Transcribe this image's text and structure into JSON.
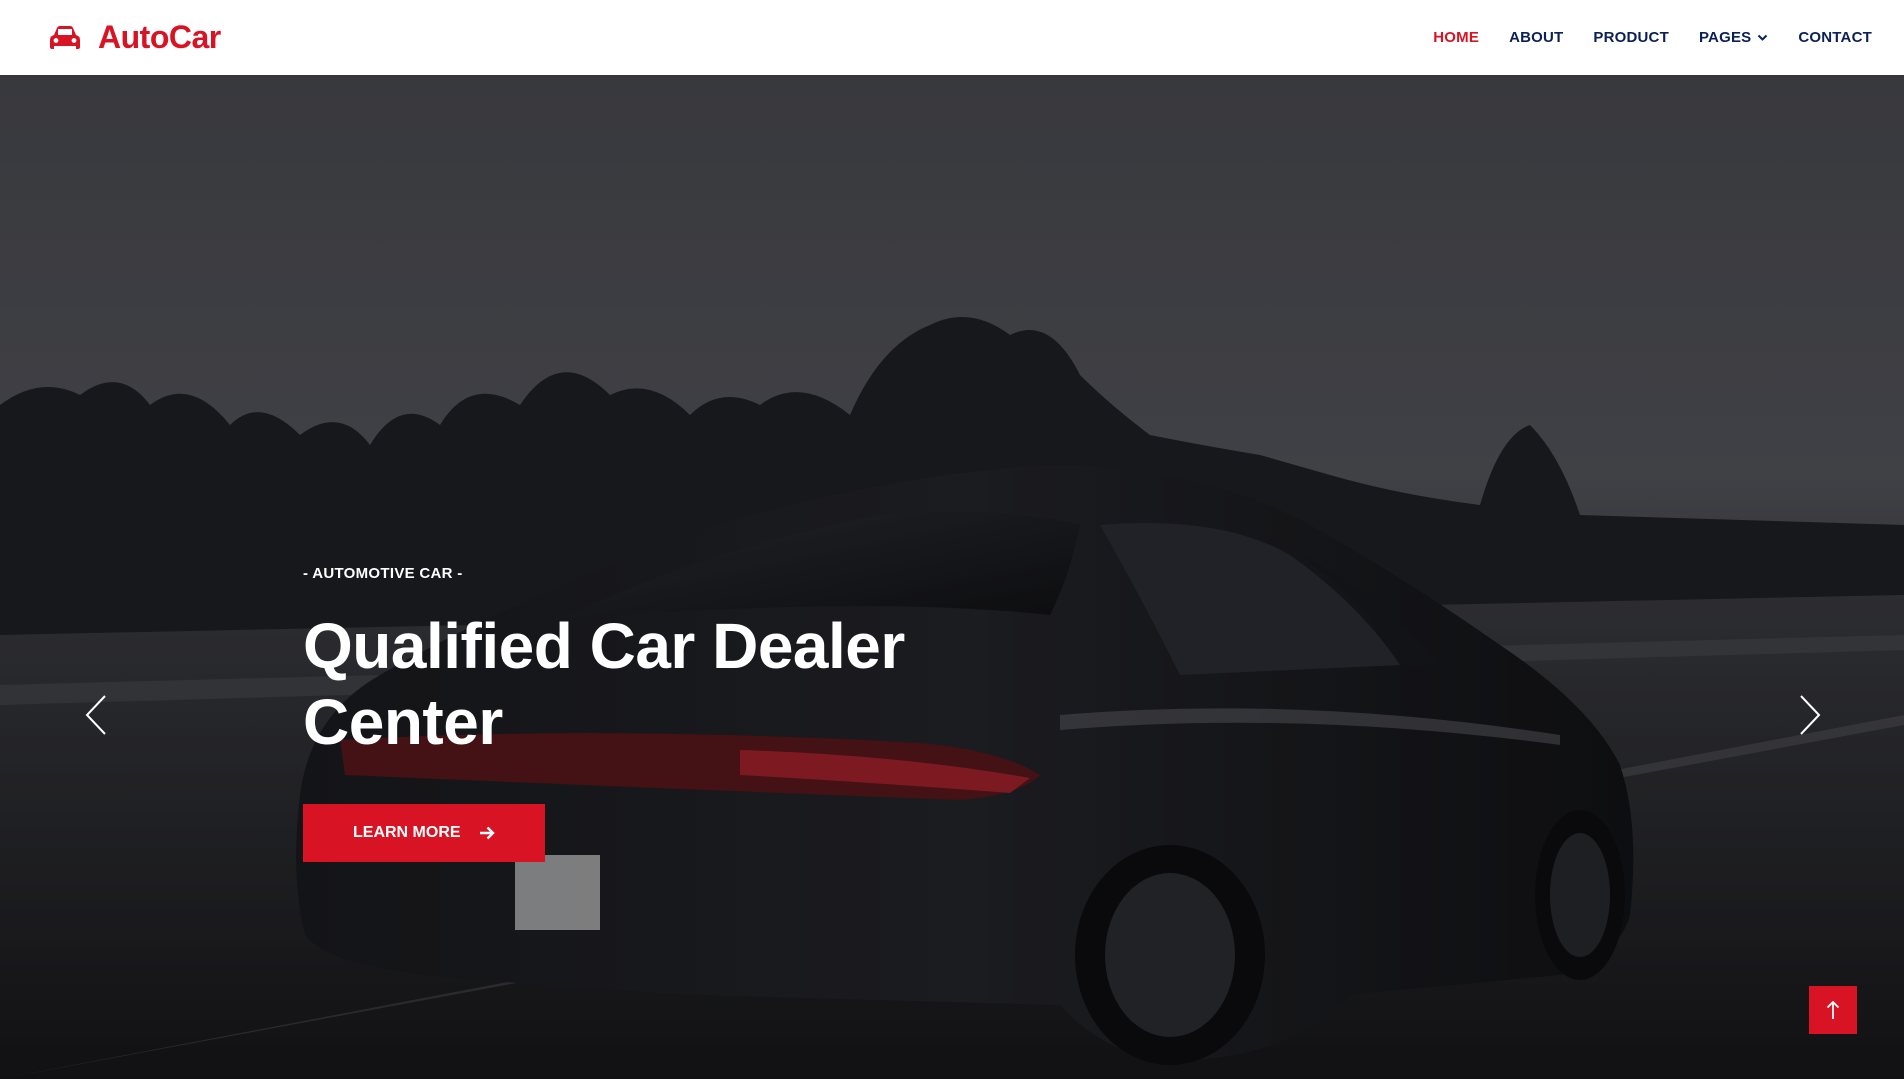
{
  "brand": {
    "name": "AutoCar",
    "icon": "car-icon",
    "color": "#D81324"
  },
  "nav": {
    "items": [
      {
        "label": "HOME",
        "active": true
      },
      {
        "label": "ABOUT",
        "active": false
      },
      {
        "label": "PRODUCT",
        "active": false
      },
      {
        "label": "PAGES",
        "active": false,
        "dropdown": true
      },
      {
        "label": "CONTACT",
        "active": false
      }
    ]
  },
  "hero": {
    "eyebrow": "- AUTOMOTIVE CAR -",
    "headline": "Qualified Car Dealer Center",
    "cta_label": "LEARN MORE",
    "cta_icon": "arrow-right-icon",
    "prev_icon": "chevron-left-icon",
    "next_icon": "chevron-right-icon"
  },
  "back_to_top": {
    "icon": "arrow-up-icon"
  },
  "colors": {
    "accent": "#D81324",
    "nav_text": "#0B2154",
    "white": "#FFFFFF"
  }
}
